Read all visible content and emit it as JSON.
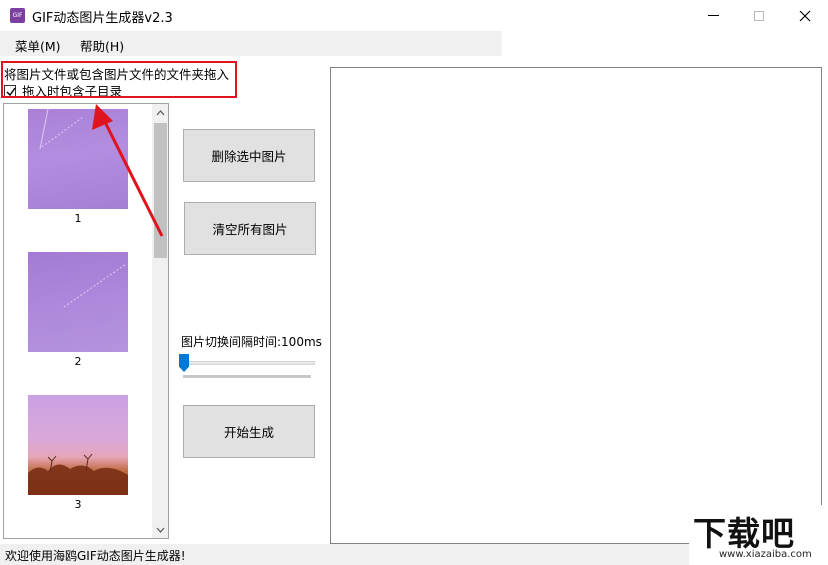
{
  "window": {
    "title": "GIF动态图片生成器v2.3",
    "icon_name": "gif-app-icon",
    "icon_text": "GIF"
  },
  "menu": {
    "items": [
      {
        "label": "菜单(M)"
      },
      {
        "label": "帮助(H)"
      }
    ]
  },
  "drop_area": {
    "hint": "将图片文件或包含图片文件的文件夹拖入",
    "include_subdirs_label": "拖入时包含子目录",
    "include_subdirs_checked": true
  },
  "thumbnails": [
    {
      "label": "1"
    },
    {
      "label": "2"
    },
    {
      "label": "3"
    }
  ],
  "buttons": {
    "delete_selected": "删除选中图片",
    "clear_all": "清空所有图片",
    "start": "开始生成"
  },
  "interval": {
    "label": "图片切换间隔时间:100ms",
    "value_ms": 100
  },
  "status": {
    "text": "欢迎使用海鸥GIF动态图片生成器!"
  },
  "watermark": {
    "main": "下载吧",
    "sub": "www.xiazaiba.com"
  },
  "colors": {
    "highlight": "#e0141e",
    "slider_accent": "#0078d7"
  }
}
